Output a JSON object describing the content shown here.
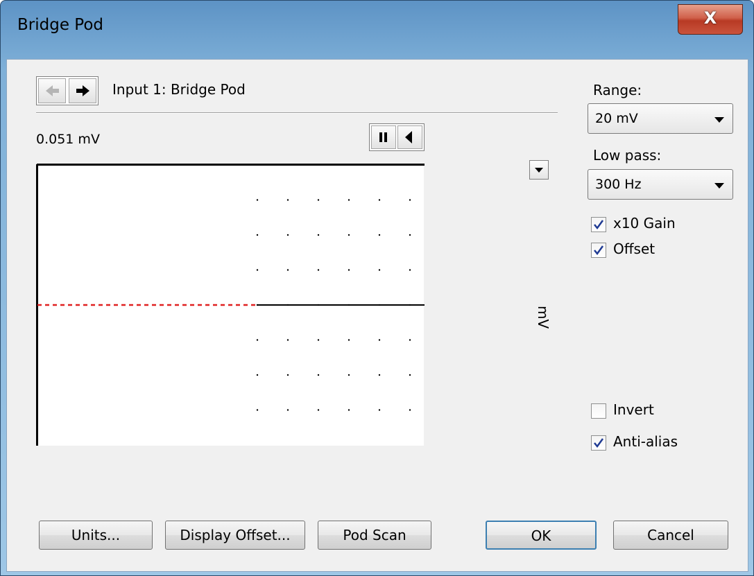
{
  "window": {
    "title": "Bridge Pod",
    "close_label": "X"
  },
  "nav": {
    "back_icon": "arrow-left-icon",
    "forward_icon": "arrow-right-icon",
    "input_label": "Input 1: Bridge Pod"
  },
  "readout": {
    "value": "0.051 mV"
  },
  "controls": {
    "pause_icon": "pause-icon",
    "scroll_icon": "triangle-left-icon",
    "axis_menu_icon": "chevron-down-icon"
  },
  "chart_data": {
    "type": "line",
    "ylabel": "mV",
    "ylim": [
      -20,
      20
    ],
    "y_ticks": [
      "20",
      "10",
      "0",
      "-10",
      "-20"
    ],
    "grid": "dotted",
    "series": [
      {
        "values": [
          0,
          0
        ],
        "color": "#e02020",
        "style": "dashed"
      }
    ]
  },
  "settings": {
    "range_label": "Range:",
    "range_value": "20 mV",
    "lowpass_label": "Low pass:",
    "lowpass_value": "300 Hz",
    "gain_label": "x10 Gain",
    "gain_checked": true,
    "offset_label": "Offset",
    "offset_checked": true,
    "invert_label": "Invert",
    "invert_checked": false,
    "antialias_label": "Anti-alias",
    "antialias_checked": true
  },
  "buttons": {
    "units": "Units...",
    "display_offset": "Display Offset...",
    "pod_scan": "Pod Scan",
    "ok": "OK",
    "cancel": "Cancel"
  }
}
